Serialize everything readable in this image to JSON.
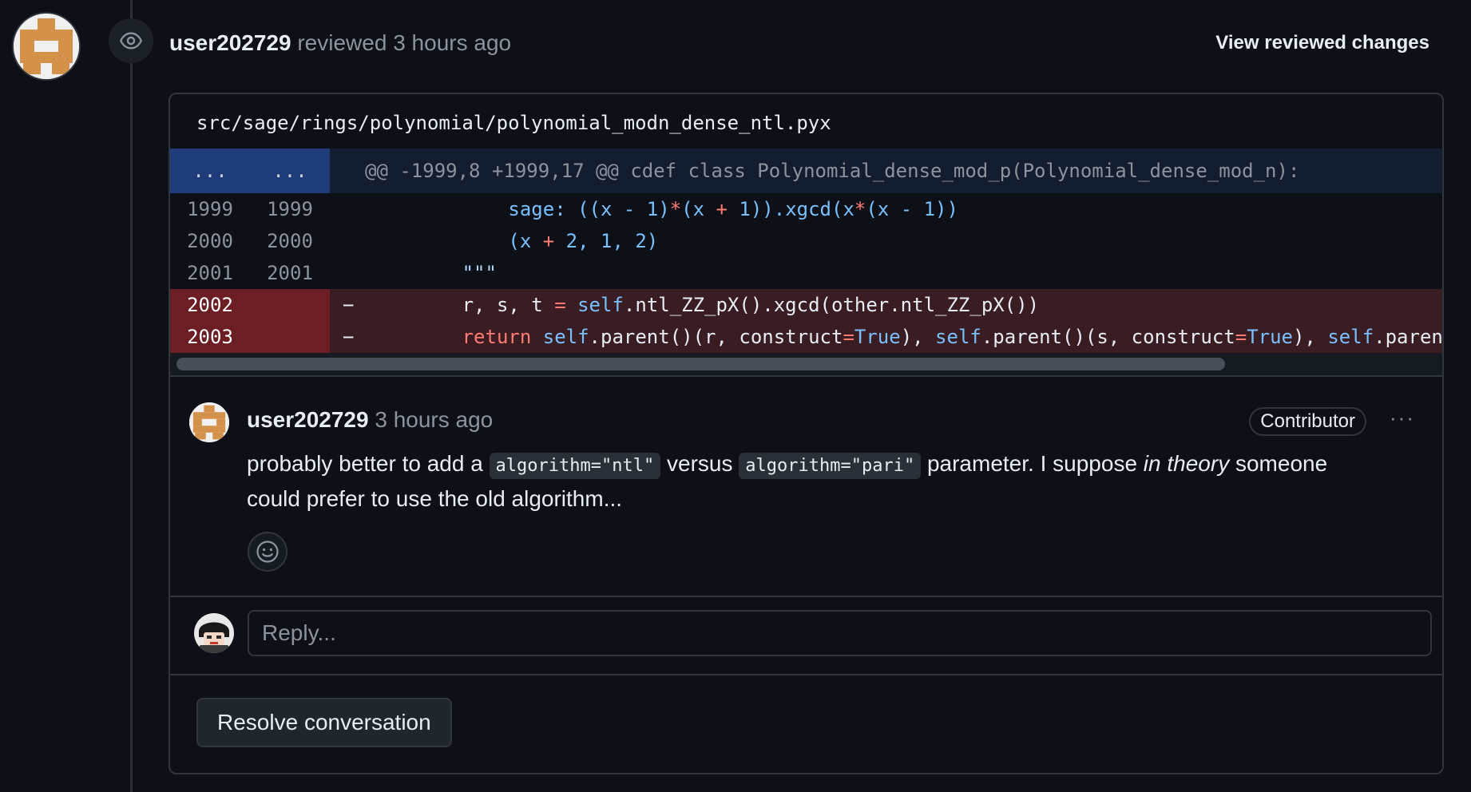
{
  "review": {
    "user": "user202729",
    "action": "reviewed",
    "time": "3 hours ago",
    "view_changes": "View reviewed changes"
  },
  "file": {
    "path": "src/sage/rings/polynomial/polynomial_modn_dense_ntl.pyx"
  },
  "diff": {
    "hunk_left": "...",
    "hunk_right": "...",
    "hunk_header": "@@ -1999,8 +1999,17 @@ cdef class Polynomial_dense_mod_p(Polynomial_dense_mod_n):",
    "lines": [
      {
        "old": "1999",
        "new": "1999",
        "type": "context"
      },
      {
        "old": "2000",
        "new": "2000",
        "type": "context"
      },
      {
        "old": "2001",
        "new": "2001",
        "type": "context"
      },
      {
        "old": "2002",
        "new": "",
        "type": "deletion",
        "sign": "−"
      },
      {
        "old": "2003",
        "new": "",
        "type": "deletion",
        "sign": "−"
      }
    ],
    "code": {
      "l1999": "sage: ((x - 1)*(x + 1)).xgcd(x*(x - 1))",
      "l2000": "(x + 2, 1, 2)",
      "l2001": "\"\"\"",
      "l2002": "r, s, t = self.ntl_ZZ_pX().xgcd(other.ntl_ZZ_pX())",
      "l2003": "return self.parent()(r, construct=True), self.parent()(s, construct=True), self.parent"
    }
  },
  "comment": {
    "user": "user202729",
    "time": "3 hours ago",
    "badge": "Contributor",
    "more": "···",
    "body_p1": "probably better to add a ",
    "code1": "algorithm=\"ntl\"",
    "body_p2": " versus ",
    "code2": "algorithm=\"pari\"",
    "body_p3": " parameter. I suppose ",
    "body_em": "in theory",
    "body_p4": " someone could prefer to use the old algorithm..."
  },
  "reply": {
    "placeholder": "Reply..."
  },
  "resolve_label": "Resolve conversation",
  "colors": {
    "background": "#0d1117",
    "hunk_bg": "#121d2f",
    "hunk_num_bg": "#1f3b7a",
    "deletion_bg": "#3a1d22",
    "deletion_num_bg": "#6b1f24",
    "avatar_orange": "#d4914a"
  }
}
